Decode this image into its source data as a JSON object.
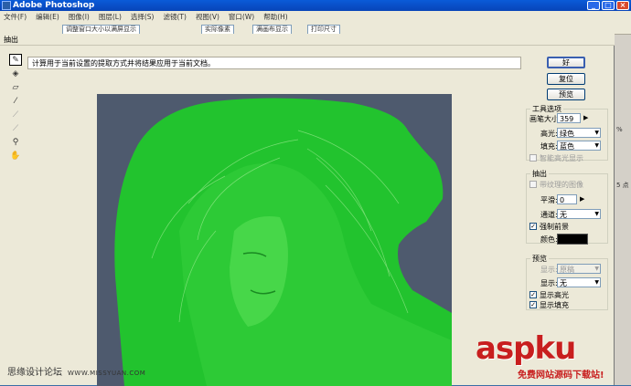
{
  "photoshop": {
    "title": "Adobe Photoshop",
    "menu": [
      "文件(F)",
      "编辑(E)",
      "图像(I)",
      "图层(L)",
      "选择(S)",
      "滤镜(T)",
      "视图(V)",
      "窗口(W)",
      "帮助(H)"
    ],
    "options_buttons": [
      "调整窗口大小以满屏显示",
      "实际像素",
      "满画布显示",
      "打印尺寸"
    ],
    "right_strip_labels": [
      "%",
      "5 点"
    ]
  },
  "dialog": {
    "title": "抽出",
    "description": "计算用于当前设置的提取方式并将结果应用于当前文档。",
    "buttons": {
      "ok": "好",
      "reset": "复位",
      "preview": "预览"
    },
    "tool_options": {
      "legend": "工具选项",
      "brush_size_label": "画笔大小:",
      "brush_size_value": "359",
      "highlight_label": "高光:",
      "highlight_value": "绿色",
      "fill_label": "填充:",
      "fill_value": "蓝色",
      "smart_highlight_label": "智能高光显示"
    },
    "extraction": {
      "legend": "抽出",
      "textured_label": "带纹理的图像",
      "smooth_label": "平滑:",
      "smooth_value": "0",
      "channel_label": "通道:",
      "channel_value": "无",
      "force_fg_label": "强制前景",
      "color_label": "颜色:"
    },
    "preview": {
      "legend": "预览",
      "show_label": "显示:",
      "show_value": "原稿",
      "display_label": "显示:",
      "display_value": "无",
      "show_highlight_label": "显示高光",
      "show_fill_label": "显示填充"
    }
  },
  "watermarks": {
    "left_text": "思缘设计论坛",
    "left_url": "WWW.MISSYUAN.COM",
    "asp_logo": "aspku",
    "asp_sub": "免费网站源码下载站!"
  },
  "colors": {
    "highlight_green": "#22c32e",
    "canvas_bg": "#4e5a6e",
    "swatch": "#000000"
  }
}
